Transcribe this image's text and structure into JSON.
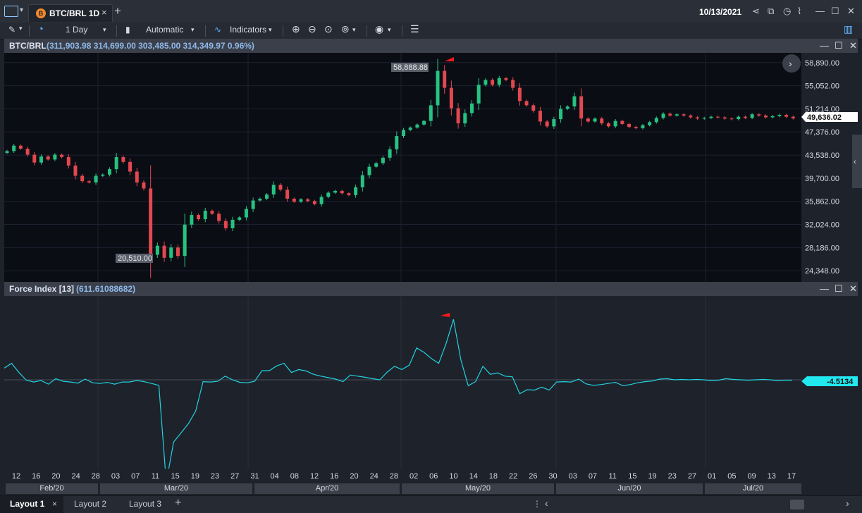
{
  "titlebar": {
    "tab_title": "BTC/BRL 1D",
    "tab_badge": "B",
    "tab_close": "×",
    "add_tab": "+",
    "date": "10/13/2021",
    "icons": [
      "share-icon",
      "export-icon",
      "clock-icon",
      "alert-icon",
      "minimize-icon",
      "maximize-icon",
      "close-icon"
    ]
  },
  "toolbar": {
    "interval": "1 Day",
    "chart_type": "Automatic",
    "indicators": "Indicators",
    "icons": [
      "pencil-icon",
      "clock-icon",
      "candle-type-icon",
      "indicators-icon",
      "zoom-in-icon",
      "zoom-out-icon",
      "zoom-fit-icon",
      "zoom-reset-icon",
      "eye-icon",
      "settings-icon",
      "panel-toggle-icon"
    ]
  },
  "price_pane": {
    "title": "BTC/BRL",
    "values": "(311,903.98  314,699.00  303,485.00  314,349.97  0.96%)",
    "y_ticks": [
      "58,890.00",
      "55,052.00",
      "51,214.00",
      "47,376.00",
      "43,538.00",
      "39,700.00",
      "35,862.00",
      "32,024.00",
      "28,186.00",
      "24,348.00"
    ],
    "last_price_label": "49,636.02",
    "high_label": "58,888.88",
    "low_label": "20,510.00"
  },
  "force_pane": {
    "title": "Force Index [13]",
    "values": "(611.61088682)",
    "last_value_label": "-4.5134"
  },
  "x_axis": {
    "ticks": [
      "12",
      "16",
      "20",
      "24",
      "28",
      "03",
      "07",
      "11",
      "15",
      "19",
      "23",
      "27",
      "31",
      "04",
      "08",
      "12",
      "16",
      "20",
      "24",
      "28",
      "02",
      "06",
      "10",
      "14",
      "18",
      "22",
      "26",
      "30",
      "03",
      "07",
      "11",
      "15",
      "19",
      "23",
      "27",
      "01",
      "05",
      "09",
      "13",
      "17"
    ],
    "months": [
      "Feb/20",
      "Mar/20",
      "Apr/20",
      "May/20",
      "Jun/20",
      "Jul/20"
    ]
  },
  "bottom": {
    "layouts": [
      "Layout 1",
      "Layout 2",
      "Layout 3"
    ],
    "active_layout": "Layout 1",
    "close": "×",
    "add": "+"
  },
  "colors": {
    "up": "#26c281",
    "down": "#e2484f",
    "force_line": "#22d3e0",
    "marker": "#ff1a1a"
  },
  "chart_data": [
    {
      "type": "candlestick",
      "title": "BTC/BRL",
      "ylim": [
        22500,
        60500
      ],
      "close": [
        44200,
        45100,
        44600,
        43600,
        42300,
        43300,
        42800,
        43600,
        43200,
        41800,
        40100,
        39200,
        39000,
        40100,
        40300,
        41200,
        43200,
        42400,
        40800,
        39000,
        38000,
        27000,
        28500,
        26500,
        28200,
        26800,
        32000,
        33600,
        32900,
        34300,
        33800,
        32600,
        31400,
        32800,
        33200,
        34600,
        36000,
        36300,
        37000,
        38600,
        37800,
        36300,
        35800,
        36200,
        35900,
        35400,
        36600,
        37300,
        37600,
        37200,
        36900,
        38200,
        40200,
        41600,
        42200,
        43100,
        44500,
        46700,
        47700,
        48100,
        48600,
        49200,
        51800,
        57500,
        54700,
        51300,
        48800,
        50500,
        52100,
        55200,
        56000,
        55200,
        56300,
        56000,
        54700,
        52500,
        51800,
        50900,
        49100,
        48300,
        49500,
        51200,
        51600,
        53300,
        49600,
        49100,
        49600,
        48800,
        48300,
        49200,
        48700,
        48200,
        48000,
        48500,
        49000,
        49700,
        50400,
        50100,
        50300,
        50100,
        49800,
        49600,
        49700,
        49900,
        49800,
        49600,
        49500,
        49900,
        49700,
        50300,
        50100,
        49800,
        50000,
        50200,
        49900,
        49636
      ]
    },
    {
      "type": "line",
      "title": "Force Index [13]",
      "series": [
        {
          "name": "Force Index [13]",
          "values": [
            320,
            450,
            200,
            -10,
            -60,
            -20,
            -120,
            30,
            -40,
            -60,
            -90,
            20,
            -80,
            -100,
            -70,
            -120,
            -60,
            -60,
            -20,
            -50,
            -100,
            -150,
            -2800,
            -1700,
            -1450,
            -1200,
            -850,
            -50,
            -60,
            -40,
            100,
            0,
            -70,
            -80,
            -40,
            250,
            250,
            380,
            450,
            200,
            280,
            240,
            150,
            100,
            60,
            20,
            -50,
            130,
            100,
            70,
            30,
            0,
            210,
            370,
            280,
            400,
            870,
            750,
            580,
            450,
            990,
            1650,
            550,
            -160,
            -50,
            370,
            150,
            190,
            100,
            80,
            -380,
            -270,
            -280,
            -200,
            -280,
            -60,
            -50,
            -60,
            20,
            -110,
            -150,
            -130,
            -100,
            -70,
            -160,
            -130,
            -80,
            -50,
            -30,
            20,
            30,
            0,
            10,
            0,
            10,
            0,
            -20,
            -10,
            30,
            10,
            0,
            -10,
            0,
            10,
            0,
            -20,
            -10,
            -10
          ]
        }
      ],
      "last_value": -4.5134
    }
  ]
}
